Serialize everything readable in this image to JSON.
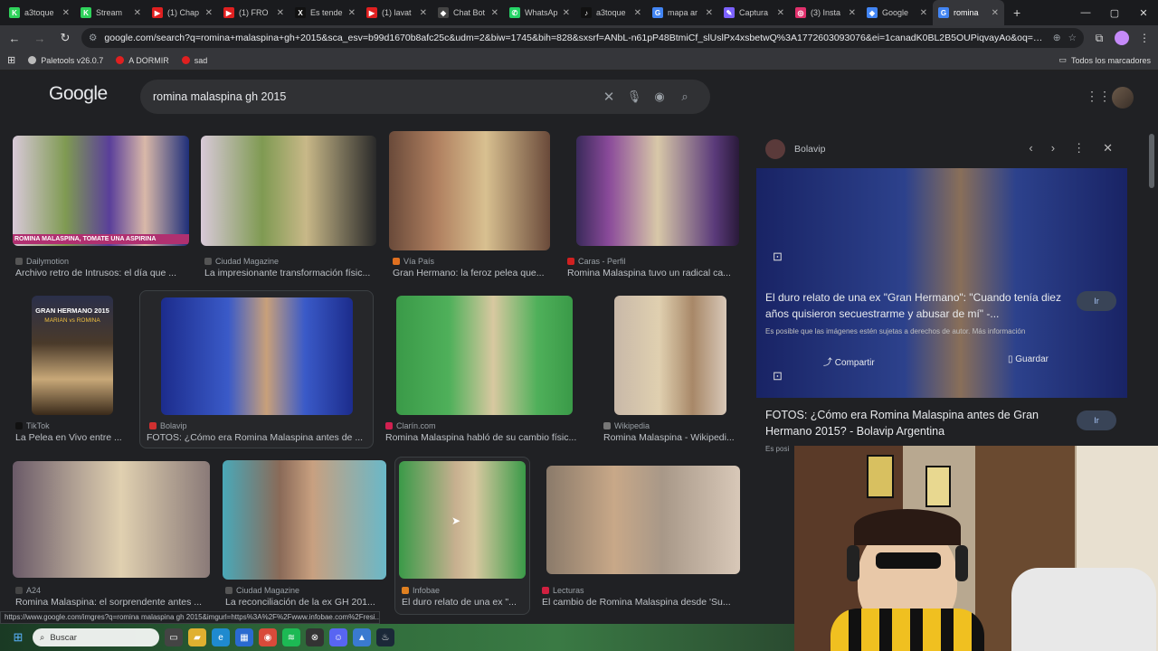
{
  "tabs": [
    {
      "title": "a3toque",
      "color": "#2fd35b",
      "glyph": "K"
    },
    {
      "title": "Stream",
      "color": "#2fd35b",
      "glyph": "K"
    },
    {
      "title": "(1) Chap",
      "color": "#e02020",
      "glyph": "▶"
    },
    {
      "title": "(1) FRO",
      "color": "#e02020",
      "glyph": "▶"
    },
    {
      "title": "Es tende",
      "color": "#111111",
      "glyph": "X"
    },
    {
      "title": "(1) lavat",
      "color": "#e02020",
      "glyph": "▶"
    },
    {
      "title": "Chat Bot",
      "color": "#444444",
      "glyph": "◆"
    },
    {
      "title": "WhatsAp",
      "color": "#25d366",
      "glyph": "✆"
    },
    {
      "title": "a3toque",
      "color": "#111111",
      "glyph": "♪"
    },
    {
      "title": "mapa ar",
      "color": "#4285f4",
      "glyph": "G"
    },
    {
      "title": "Captura",
      "color": "#7b61ff",
      "glyph": "✎"
    },
    {
      "title": "(3) Insta",
      "color": "#e1306c",
      "glyph": "◎"
    },
    {
      "title": "Google",
      "color": "#4285f4",
      "glyph": "◆"
    },
    {
      "title": "romina",
      "color": "#4285f4",
      "glyph": "G",
      "active": true
    }
  ],
  "omnibox": {
    "url": "google.com/search?q=romina+malaspina+gh+2015&sca_esv=b99d1670b8afc25c&udm=2&biw=1745&bih=828&sxsrf=ANbL-n61pP48BtmiCf_slUslPx4xsbetwQ%3A1772603093076&ei=1canadK0BL2B5OUPiqvayAo&oq=romina+malaspina+gh&gs_..."
  },
  "bookmarks": [
    {
      "label": "Paletools v26.0.7",
      "color": "#bbbbbb"
    },
    {
      "label": "A DORMIR",
      "color": "#e02020"
    },
    {
      "label": "sad",
      "color": "#e02020"
    }
  ],
  "bookmarks_all": "Todos los marcadores",
  "search": {
    "logo": "Google",
    "query": "romina malaspina gh 2015"
  },
  "results": [
    {
      "source": "Dailymotion",
      "title": "Archivo retro de Intrusos: el día que ...",
      "srcColor": "#555"
    },
    {
      "source": "Ciudad Magazine",
      "title": "La impresionante transformación físic...",
      "srcColor": "#555"
    },
    {
      "source": "Vía País",
      "title": "Gran Hermano: la feroz pelea que...",
      "srcColor": "#e07020"
    },
    {
      "source": "Caras - Perfil",
      "title": "Romina Malaspina tuvo un radical ca...",
      "srcColor": "#d02020"
    },
    {
      "source": "TikTok",
      "title": "La Pelea en Vivo entre ...",
      "srcColor": "#111"
    },
    {
      "source": "Bolavip",
      "title": "FOTOS: ¿Cómo era Romina Malaspina antes de ...",
      "srcColor": "#d03030"
    },
    {
      "source": "Clarín.com",
      "title": "Romina Malaspina habló de su cambio físic...",
      "srcColor": "#d02050"
    },
    {
      "source": "Wikipedia",
      "title": "Romina Malaspina - Wikipedi...",
      "srcColor": "#777"
    },
    {
      "source": "A24",
      "title": "Romina Malaspina: el sorprendente antes ...",
      "srcColor": "#444"
    },
    {
      "source": "Ciudad Magazine",
      "title": "La reconciliación de la ex GH 201...",
      "srcColor": "#555"
    },
    {
      "source": "Infobae",
      "title": "El duro relato de una ex \"...",
      "srcColor": "#e08020"
    },
    {
      "source": "Lecturas",
      "title": "El cambio de Romina Malaspina desde 'Su...",
      "srcColor": "#d02040"
    }
  ],
  "thumb_text": {
    "r1c1_caption": "ROMINA MALASPINA, TOMATE UNA ASPIRINA",
    "r2c1_top": "GRAN HERMANO 2015",
    "r2c1_sub": "MARIAN vs ROMINA"
  },
  "panel": {
    "source": "Bolavip",
    "overlay_title": "El duro relato de una ex \"Gran Hermano\": \"Cuando tenía diez años quisieron secuestrarme y abusar de mí\" -...",
    "overlay_note": "Es posible que las imágenes estén sujetas a derechos de autor. Más información",
    "visit": "Ir",
    "share": "Compartir",
    "save": "Guardar",
    "title": "FOTOS: ¿Cómo era Romina Malaspina antes de Gran Hermano 2015? - Bolavip Argentina",
    "more": "Es posi"
  },
  "status_url": "https://www.google.com/imgres?q=romina malaspina gh 2015&imgurl=https%3A%2F%2Fwww.infobae.com%2Fresi...",
  "taskbar": {
    "search": "Buscar"
  }
}
